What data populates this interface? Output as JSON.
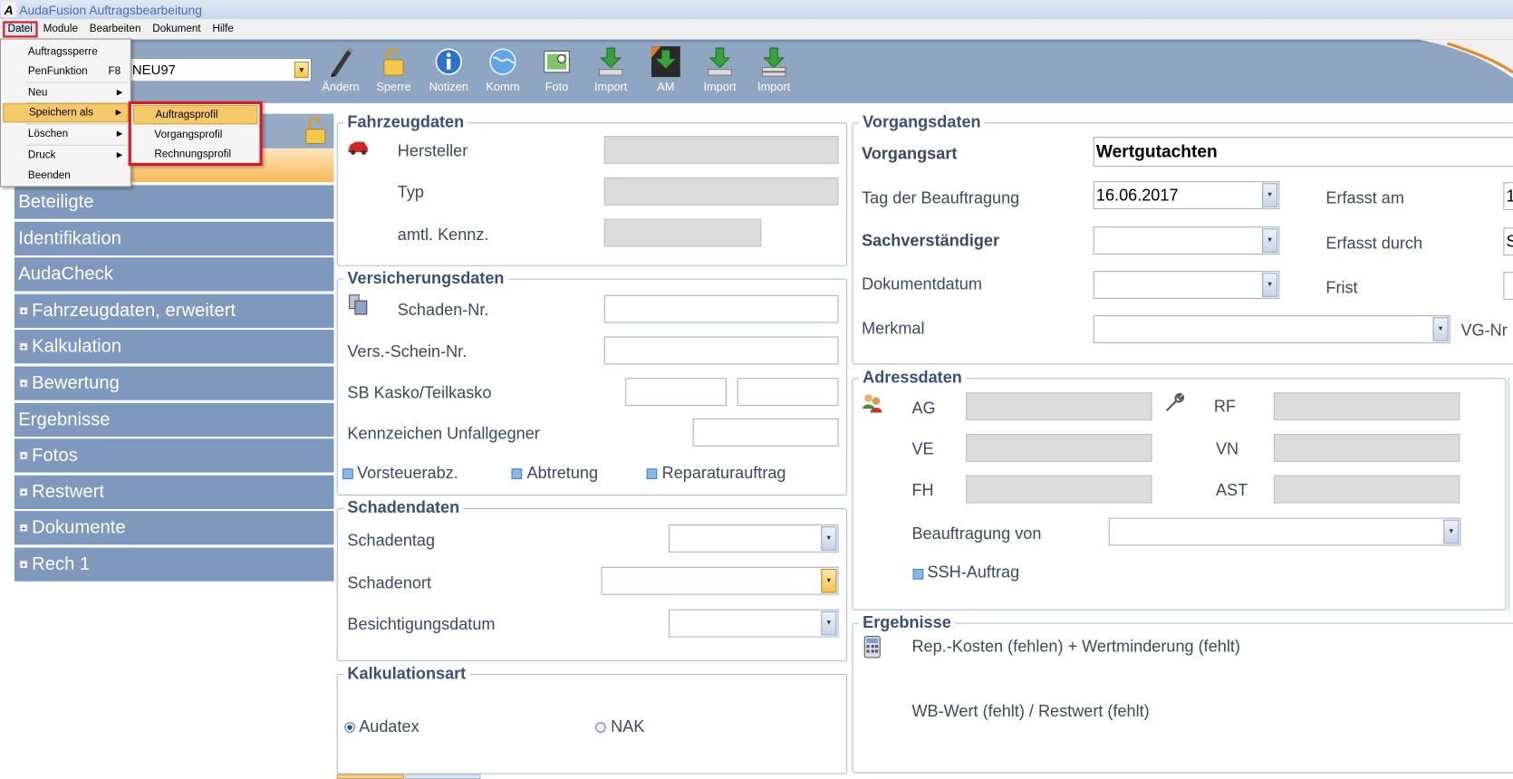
{
  "window": {
    "title": "AudaFusion Auftragsbearbeitung",
    "logo": "A"
  },
  "menubar": [
    "Datei",
    "Module",
    "Bearbeiten",
    "Dokument",
    "Hilfe"
  ],
  "file_menu": {
    "items": [
      {
        "label": "Auftragssperre",
        "shortcut": ""
      },
      {
        "label": "PenFunktion",
        "shortcut": "F8"
      },
      {
        "label": "Neu",
        "shortcut": ""
      },
      {
        "label": "Speichern als",
        "shortcut": ""
      },
      {
        "label": "Löschen",
        "shortcut": ""
      },
      {
        "label": "Druck",
        "shortcut": ""
      },
      {
        "label": "Beenden",
        "shortcut": ""
      }
    ],
    "submenu_arrow": "▶"
  },
  "save_as_submenu": [
    "Auftragsprofil",
    "Vorgangsprofil",
    "Rechnungsprofil"
  ],
  "toolbar": {
    "combo_value": "NEU97",
    "buttons": [
      "Ändern",
      "Sperre",
      "Notizen",
      "Komm",
      "Foto",
      "Import",
      "AM",
      "Import",
      "Import"
    ]
  },
  "left_nav": [
    "Beteiligte",
    "Identifikation",
    "AudaCheck",
    "Fahrzeugdaten, erweitert",
    "Kalkulation",
    "Bewertung",
    "Ergebnisse",
    "Fotos",
    "Restwert",
    "Dokumente",
    "Rech 1"
  ],
  "left_nav_expand_symbol": "+",
  "fahrzeugdaten": {
    "title": "Fahrzeugdaten",
    "hersteller": "Hersteller",
    "typ": "Typ",
    "kennz": "amtl. Kennz."
  },
  "versicherungsdaten": {
    "title": "Versicherungsdaten",
    "schaden_nr": "Schaden-Nr.",
    "vers_schein": "Vers.-Schein-Nr.",
    "sb_kasko": "SB Kasko/Teilkasko",
    "kennzeichen_gegner": "Kennzeichen Unfallgegner",
    "vorsteuer": "Vorsteuerabz.",
    "abtretung": "Abtretung",
    "reparaturauftrag": "Reparaturauftrag"
  },
  "schadendaten": {
    "title": "Schadendaten",
    "schadentag": "Schadentag",
    "schadenort": "Schadenort",
    "besichtigung": "Besichtigungsdatum"
  },
  "kalkulationsart": {
    "title": "Kalkulationsart",
    "audatex": "Audatex",
    "nak": "NAK"
  },
  "vorgangsdaten": {
    "title": "Vorgangsdaten",
    "vorgangsart_label": "Vorgangsart",
    "vorgangsart_value": "Wertgutachten",
    "tag_label": "Tag der Beauftragung",
    "tag_value": "16.06.2017",
    "sachverstaendiger": "Sachverständiger",
    "dokumentdatum": "Dokumentdatum",
    "merkmal": "Merkmal",
    "erfasst_am": "Erfasst am",
    "erfasst_am_value": "1",
    "erfasst_durch": "Erfasst durch",
    "erfasst_durch_value": "S",
    "frist": "Frist",
    "vg_nr": "VG-Nr"
  },
  "adressdaten": {
    "title": "Adressdaten",
    "ag": "AG",
    "ve": "VE",
    "fh": "FH",
    "rf": "RF",
    "vn": "VN",
    "ast": "AST",
    "beauftragung": "Beauftragung von",
    "ssh": "SSH-Auftrag"
  },
  "ergebnisse": {
    "title": "Ergebnisse",
    "line1": "Rep.-Kosten (fehlen) + Wertminderung (fehlt)",
    "line2": "WB-Wert (fehlt) / Restwert (fehlt)"
  },
  "dropdown_arrow": "▼",
  "colors": {
    "accent_red": "#e0141e",
    "nav_blue": "#7e99bd",
    "toolbar": "#8fa6c2",
    "highlight": "#f5c86a"
  }
}
